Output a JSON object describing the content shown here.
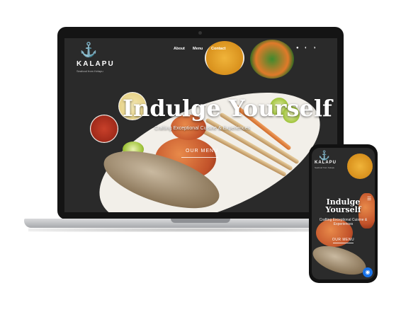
{
  "site": {
    "brand": "KALAPU",
    "tagline": "Seafood from Kelapu",
    "nav": [
      "About",
      "Menu",
      "Contact"
    ],
    "social_icons": [
      "facebook-icon",
      "instagram-icon",
      "whatsapp-icon"
    ]
  },
  "hero": {
    "title": "Indulge Yourself",
    "subtitle": "Crafting Exceptional Cuisine & Experiences",
    "cta": "OUR MENU"
  },
  "mobile": {
    "brand": "KALAPU",
    "tagline": "Seafood from Kelapu",
    "title_line1": "Indulge",
    "title_line2": "Yourself",
    "subtitle_line1": "Crafting Exceptional Cuisine &",
    "subtitle_line2": "Experiences",
    "cta": "OUR MENU",
    "menu_icon": "hamburger-icon",
    "chat_icon": "chat-icon"
  },
  "colors": {
    "background": "#2a2a2a",
    "text": "#ffffff",
    "chat_button": "#1a73e8"
  }
}
